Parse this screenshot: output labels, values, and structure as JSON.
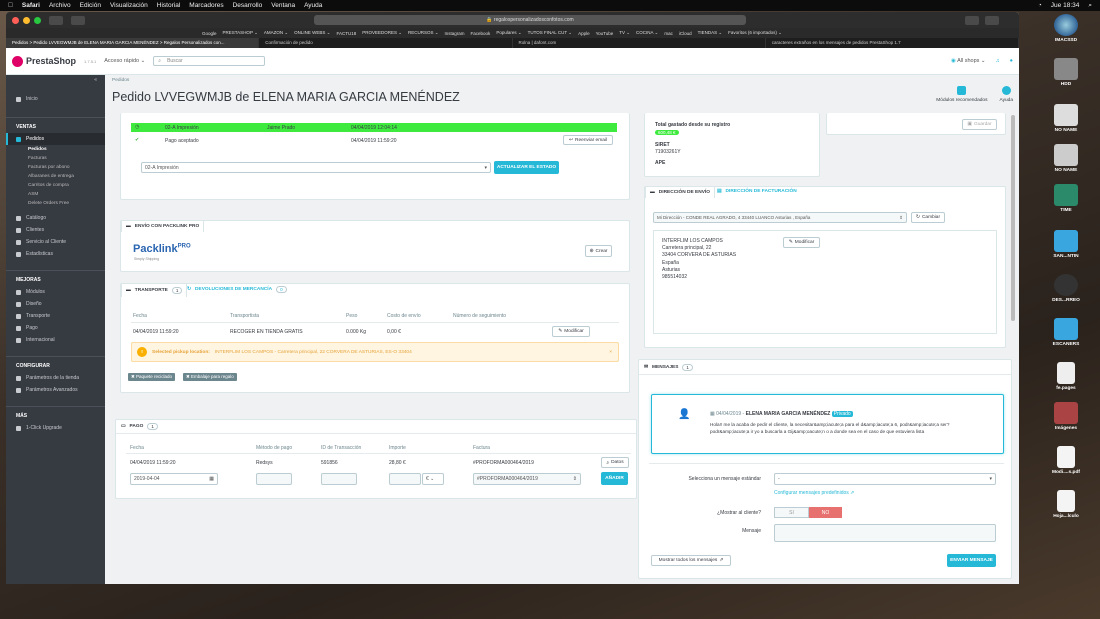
{
  "menubar": {
    "apple": "",
    "app": "Safari",
    "items": [
      "Archivo",
      "Edición",
      "Visualización",
      "Historial",
      "Marcadores",
      "Desarrollo",
      "Ventana",
      "Ayuda"
    ],
    "clock": "Jue 18:34"
  },
  "browser": {
    "url": "regalospersonalizadosconfotos.com",
    "bookmarks": [
      "Google",
      "PRESTASHOP ⌄",
      "AMAZON ⌄",
      "ONLINE WEBS ⌄",
      "FACTU18",
      "PROVEEDORES ⌄",
      "RECURSOS ⌄",
      "Instagram",
      "Facebook",
      "Populares ⌄",
      "TUTOS FINAL CUT ⌄",
      "Apple",
      "YouTube",
      "TV ⌄",
      "COCINA ⌄",
      "mac",
      "iCloud",
      "TIENDAS ⌄",
      "Favoritos (6 importados) ⌄"
    ],
    "tabs": [
      "Pedidos > Pedido LVVEGWMJB de ELENA MARIA GARCIA MENÉNDEZ > Regalos Personalizados con...",
      "Confirmación de pedido",
      "Rolna | dafont.com",
      "caracteres extraños en los mensajes de pedidos PrestaShop 1.7"
    ]
  },
  "header": {
    "logo": "PrestaShop",
    "version": "1.7.5.1",
    "quick_access": "Acceso rápido ⌄",
    "search_placeholder": "Buscar",
    "shops": "All shops ⌄"
  },
  "sidebar": {
    "collapse": "«",
    "home": "Inicio",
    "sections": [
      {
        "title": "VENTAS",
        "items": [
          {
            "label": "Pedidos",
            "subs": [
              "Pedidos",
              "Facturas",
              "Facturas por abono",
              "Albaranes de entrega",
              "Carritos de compra",
              "ASM",
              "Delete Orders Free"
            ]
          },
          {
            "label": "Catálogo"
          },
          {
            "label": "Clientes"
          },
          {
            "label": "Servicio al Cliente"
          },
          {
            "label": "Estadísticas"
          }
        ]
      },
      {
        "title": "MEJORAS",
        "items": [
          {
            "label": "Módulos"
          },
          {
            "label": "Diseño"
          },
          {
            "label": "Transporte"
          },
          {
            "label": "Pago"
          },
          {
            "label": "Internacional"
          }
        ]
      },
      {
        "title": "CONFIGURAR",
        "items": [
          {
            "label": "Parámetros de la tienda"
          },
          {
            "label": "Parámetros Avanzados"
          }
        ]
      },
      {
        "title": "MÁS",
        "items": [
          {
            "label": "1-Click Upgrade"
          }
        ]
      }
    ]
  },
  "page": {
    "breadcrumb": "Pedidos",
    "title": "Pedido LVVEGWMJB de ELENA MARIA GARCIA MENÉNDEZ",
    "tools": [
      "Módulos recomendados",
      "Ayuda"
    ]
  },
  "status": {
    "rows": [
      {
        "label": "02-A Impresión",
        "user": "Jaime Prado",
        "date": "04/04/2019 12:04:14"
      },
      {
        "label": "Pago aceptado",
        "user": "",
        "date": "04/04/2019 11:59:20"
      }
    ],
    "resend": "Reenviar email",
    "select": "02-A Impresión",
    "update": "ACTUALIZAR EL ESTADO"
  },
  "packlink": {
    "tab": "ENVÍO CON PACKLINK PRO",
    "logo": "Packlink",
    "logo_pro": "PRO",
    "tagline": "Simply Shipping",
    "create": "Crear"
  },
  "shipping": {
    "tab_transport": "TRANSPORTE",
    "tab_transport_count": "1",
    "tab_returns": "DEVOLUCIONES DE MERCANCÍA",
    "tab_returns_count": "0",
    "columns": [
      "Fecha",
      "Transportista",
      "Peso",
      "Costo de envío",
      "Número de seguimiento"
    ],
    "row": [
      "04/04/2019 11:59:20",
      "RECOGER EN TIENDA GRATIS",
      "0.000 Kg",
      "0,00 €",
      ""
    ],
    "modify": "Modificar",
    "alert_strong": "Selected pickup location:",
    "alert_text": "INTERFLIM LOS CAMPOS - Carretera principal, 22 CORVERA DE ASTURIAS, ES-O 33404",
    "tags": [
      "Paquete reciclado",
      "Embalaje para regalo"
    ]
  },
  "payment": {
    "title": "PAGO",
    "count": "1",
    "columns": [
      "Fecha",
      "Método de pago",
      "ID de Transacción",
      "Importe",
      "Factura"
    ],
    "row": [
      "04/04/2019 11:59:20",
      "Redsys",
      "591856",
      "28,80 €",
      "#PROFORMA000464/2019"
    ],
    "details": "Datos",
    "new_date": "2019-04-04",
    "currency": "€ ⌄",
    "invoice_select": "#PROFORMA000464/2019",
    "add": "AÑADIR"
  },
  "customer": {
    "total_label": "Total gastado desde su registro",
    "total_value": "600,48 €",
    "siret_label": "SIRET",
    "siret_value": "71903261Y",
    "ape_label": "APE",
    "save": "Guardar"
  },
  "address": {
    "tab_ship": "DIRECCIÓN DE ENVÍO",
    "tab_invoice": "DIRECCIÓN DE FACTURACIÓN",
    "select": "Mi Dirección - CONDE REAL AGRADO, 4 33440 LUANCO Asturias , España",
    "change": "Cambiar",
    "lines": [
      "INTERFLIM LOS CAMPOS",
      "Carretera principal, 22",
      "33404 CORVERA DE ASTURIAS",
      "España",
      "Asturias",
      "985514032"
    ],
    "modify": "Modificar"
  },
  "messages": {
    "title": "MENSAJES",
    "count": "1",
    "date": "04/04/2019",
    "author": "ELENA MARIA GARCIA MENÉNDEZ",
    "private": "Privado",
    "text1": "Hola!! me la acaba de pedir el cliente, la necesitar&amp;iacute;a para el d&amp;iacute;a 6, podr&amp;iacute;a ser?",
    "text2": "podr&amp;iacute;a ir yo a buscarla a Gij&amp;oacute;n o a donde sea en el caso de que estuviera lista",
    "select_label": "Selecciona un mensaje estándar",
    "select_value": "-",
    "configure": "Configurar mensajes predefinidos",
    "show_label": "¿Mostrar al cliente?",
    "yes": "SI",
    "no": "NO",
    "message_label": "Mensaje",
    "show_all": "Mostrar todos los mensajes",
    "send": "ENVIAR MENSAJE"
  },
  "dock": [
    "IMACSSD",
    "HDD",
    "NO NAME",
    "NO NAME",
    "TIME",
    "SAN...NTIN",
    "DES...RREO",
    "ESCANERS",
    "fe.pages",
    "Imágenes",
    "Modi....s.pdf",
    "Hoja...lculo"
  ],
  "colors": {
    "accent": "#25b9d7",
    "status_green": "#3eea3e",
    "sidebar": "#363a41",
    "brand": "#df0067"
  }
}
